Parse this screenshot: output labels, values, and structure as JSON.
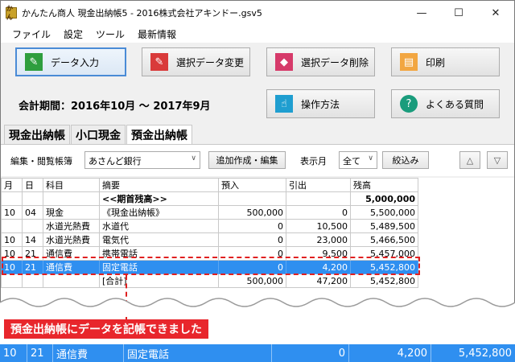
{
  "window": {
    "icon": "かん",
    "title": "かんたん商人 現金出納帳5 - 2016株式会社アキンドー.gsv5",
    "minimize": "—",
    "maximize": "☐",
    "close": "✕"
  },
  "menu": [
    "ファイル",
    "設定",
    "ツール",
    "最新情報"
  ],
  "toolbar": {
    "data_entry": "データ入力",
    "change_selected": "選択データ変更",
    "delete_selected": "選択データ削除",
    "print": "印刷",
    "how_to": "操作方法",
    "faq": "よくある質問"
  },
  "period": "会計期間：2016年10月 ～ 2017年9月",
  "tabs": [
    "現金出納帳",
    "小口現金",
    "預金出納帳"
  ],
  "filter": {
    "ledger_label": "編集・閲覧帳簿",
    "ledger_value": "あさんど銀行",
    "add_edit": "追加作成・編集",
    "month_label": "表示月",
    "month_value": "全て",
    "narrow": "絞込み",
    "up": "△",
    "down": "▽"
  },
  "table": {
    "headers": [
      "月",
      "日",
      "科目",
      "摘要",
      "預入",
      "引出",
      "残高"
    ],
    "rows": [
      [
        "",
        "",
        "",
        "<<期首残高>>",
        "",
        "",
        "5,000,000"
      ],
      [
        "10",
        "04",
        "現金",
        "《現金出納帳》",
        "500,000",
        "0",
        "5,500,000"
      ],
      [
        "",
        "",
        "水道光熱費",
        "水道代",
        "0",
        "10,500",
        "5,489,500"
      ],
      [
        "10",
        "14",
        "水道光熱費",
        "電気代",
        "0",
        "23,000",
        "5,466,500"
      ],
      [
        "10",
        "21",
        "通信費",
        "携帯電話",
        "0",
        "9,500",
        "5,457,000"
      ],
      [
        "10",
        "21",
        "通信費",
        "固定電話",
        "0",
        "4,200",
        "5,452,800"
      ],
      [
        "",
        "",
        "",
        "[合計]",
        "500,000",
        "47,200",
        "5,452,800"
      ]
    ]
  },
  "callout": "預金出納帳にデータを記帳できました",
  "zoom_row": [
    "10",
    "21",
    "通信費",
    "固定電話",
    "0",
    "4,200",
    "5,452,800"
  ],
  "colors": {
    "selection": "#2f8ff0",
    "callout": "#e8262c"
  }
}
